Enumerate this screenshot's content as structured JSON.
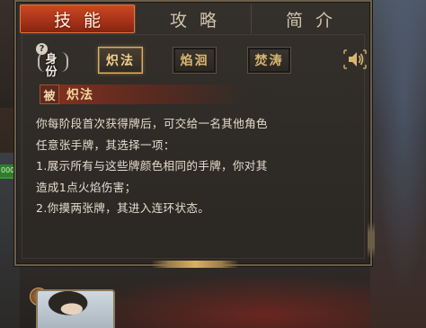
{
  "tabs": [
    {
      "label": "技能",
      "active": true
    },
    {
      "label": "攻略",
      "active": false
    },
    {
      "label": "简介",
      "active": false
    }
  ],
  "identity": {
    "help": "?",
    "label": "身份"
  },
  "skills": [
    {
      "label": "炽法",
      "active": true
    },
    {
      "label": "焰洄",
      "active": false
    },
    {
      "label": "焚涛",
      "active": false
    }
  ],
  "voice_icon": "speaker-icon",
  "skill_detail": {
    "type": "被",
    "name": "炽法",
    "description": [
      "你每阶段首次获得牌后，可交给一名其他角色",
      "任意张手牌，其选择一项：",
      "1.展示所有与这些牌颜色相同的手牌，你对其",
      "造成1点火焰伤害；",
      "2.你摸两张牌，其进入连环状态。"
    ]
  },
  "side": {
    "badge_text": "000"
  },
  "colors": {
    "tab_active": "#b8391b",
    "skill_gold": "#f2d08a",
    "text": "#e4dccd",
    "panel": "#2f2b27"
  }
}
